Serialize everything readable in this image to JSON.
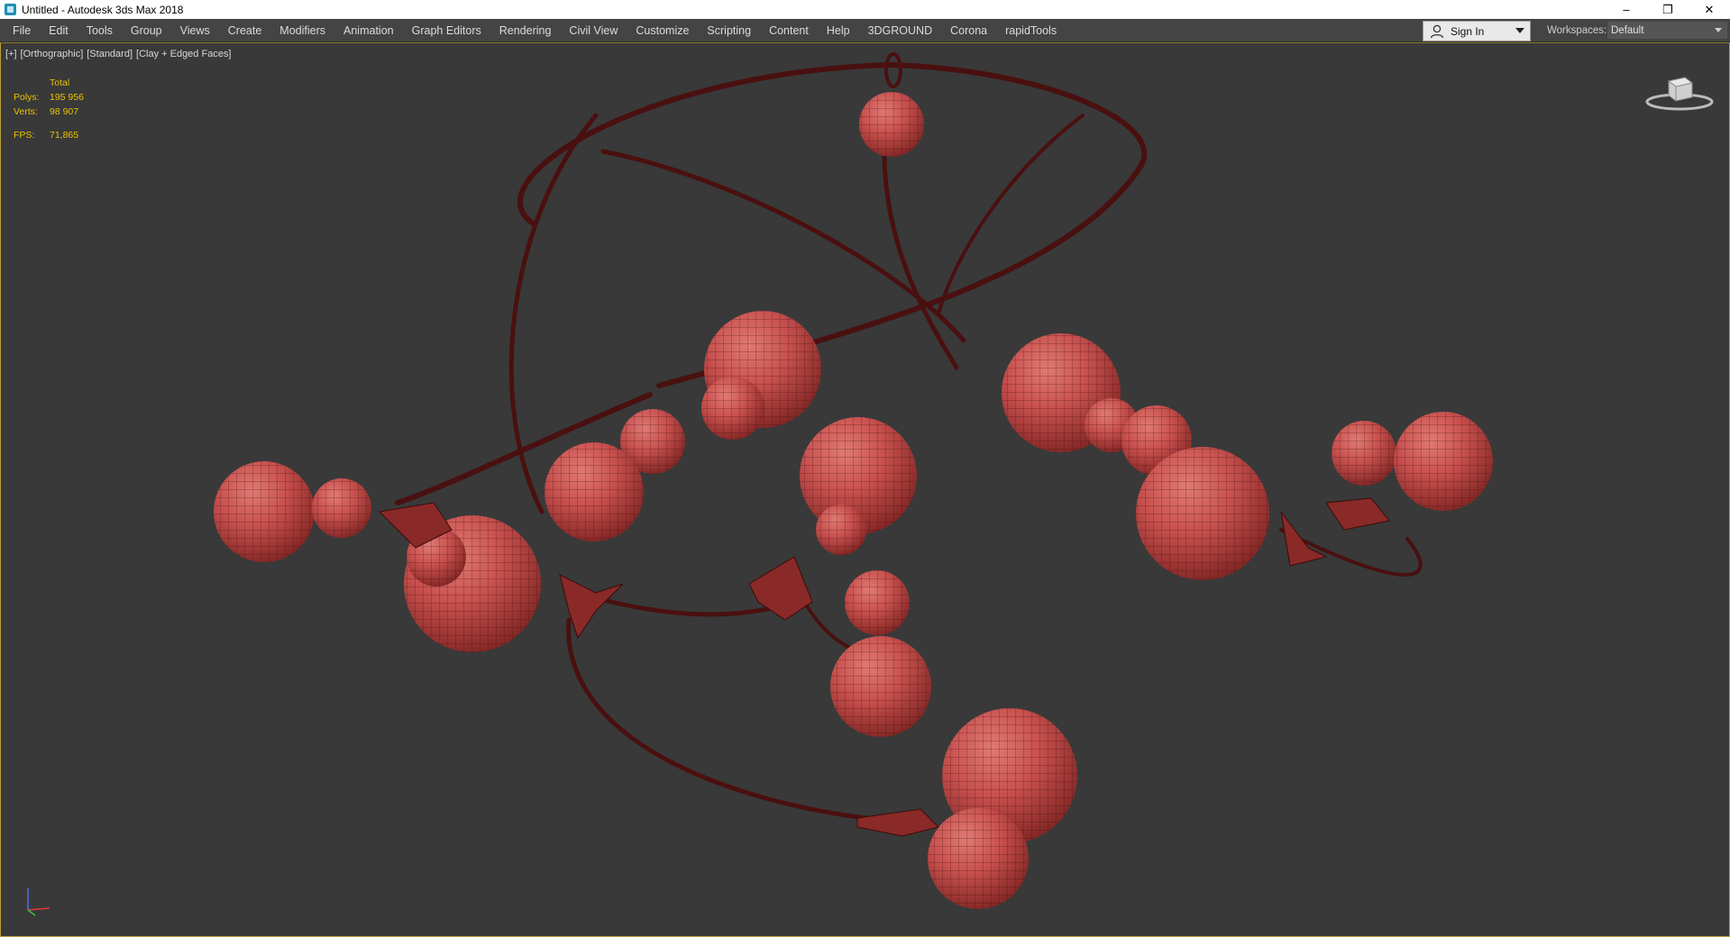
{
  "window": {
    "title": "Untitled - Autodesk 3ds Max 2018",
    "controls": {
      "minimize": "–",
      "restore": "❐",
      "close": "✕"
    }
  },
  "menu": {
    "items": [
      "File",
      "Edit",
      "Tools",
      "Group",
      "Views",
      "Create",
      "Modifiers",
      "Animation",
      "Graph Editors",
      "Rendering",
      "Civil View",
      "Customize",
      "Scripting",
      "Content",
      "Help",
      "3DGROUND",
      "Corona",
      "rapidTools"
    ],
    "sign_in": "Sign In",
    "workspaces_label": "Workspaces:",
    "workspace_value": "Default"
  },
  "viewport": {
    "labels": [
      "[+]",
      "[Orthographic]",
      "[Standard]",
      "[Clay + Edged Faces]"
    ],
    "stats": {
      "header": "Total",
      "polys_label": "Polys:",
      "polys": "195 956",
      "verts_label": "Verts:",
      "verts": "98 907",
      "fps_label": "FPS:",
      "fps": "71,865"
    }
  },
  "colors": {
    "viewport_bg": "#393939",
    "menu_bg": "#444444",
    "sphere": "#c8514f",
    "wire": "#4a1010",
    "stats_text": "#e8c400"
  },
  "icons": [
    "user-icon",
    "viewcube-icon",
    "axis-tripod-icon",
    "app-logo-icon"
  ]
}
